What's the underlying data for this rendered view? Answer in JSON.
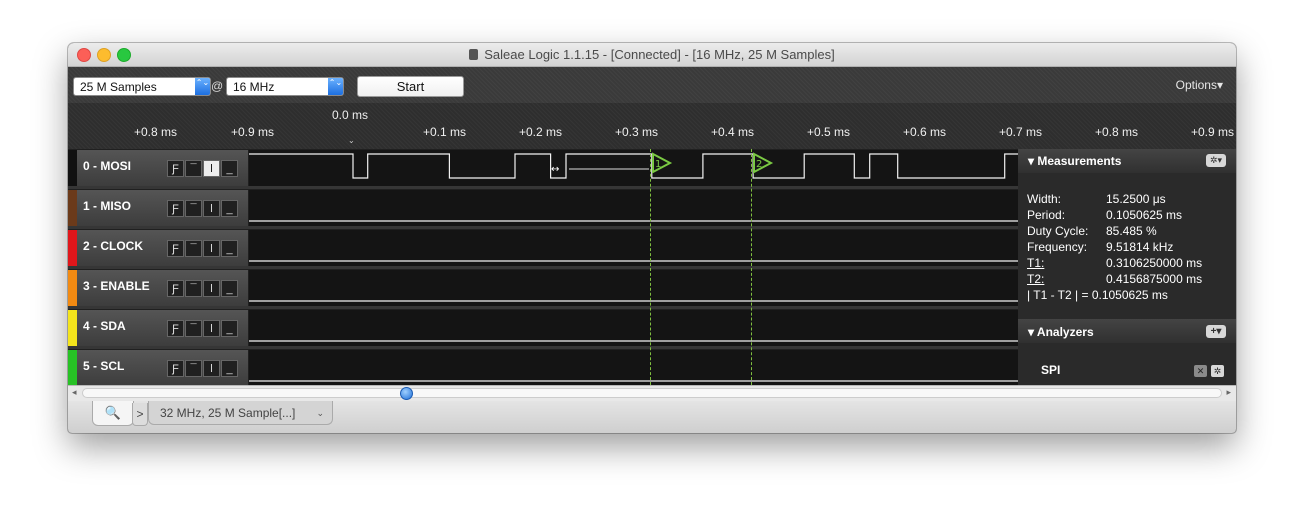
{
  "window": {
    "title": "Saleae Logic 1.1.15 - [Connected] - [16 MHz, 25 M Samples]"
  },
  "toolbar": {
    "samples_value": "25 M Samples",
    "at_symbol": "@",
    "rate_value": "16 MHz",
    "start_label": "Start",
    "options_label": "Options▾",
    "select_arrow": "⌃⌄"
  },
  "ruler": {
    "zero_label": "0.0 ms",
    "ticks": [
      "+0.8 ms",
      "+0.9 ms",
      "+0.1 ms",
      "+0.2 ms",
      "+0.3 ms",
      "+0.4 ms",
      "+0.5 ms",
      "+0.6 ms",
      "+0.7 ms",
      "+0.8 ms",
      "+0.9 ms"
    ]
  },
  "channels": [
    {
      "name": "0 - MOSI",
      "color": "#111111"
    },
    {
      "name": "1 - MISO",
      "color": "#6b3a1a"
    },
    {
      "name": "2 - CLOCK",
      "color": "#e0161b"
    },
    {
      "name": "3 - ENABLE",
      "color": "#f28a12"
    },
    {
      "name": "4 - SDA",
      "color": "#f4e41c"
    },
    {
      "name": "5 - SCL",
      "color": "#27c125"
    }
  ],
  "trigger_glyphs": [
    "Ƒ",
    "¯",
    "Ɩ",
    "_"
  ],
  "markers": {
    "m1": "1",
    "m2": "2"
  },
  "measurements": {
    "title": "Measurements",
    "gear": "✲▾",
    "rows": [
      {
        "label": "Width:",
        "value": "15.2500 μs"
      },
      {
        "label": "Period:",
        "value": "0.1050625 ms"
      },
      {
        "label": "Duty Cycle:",
        "value": "85.485 %"
      },
      {
        "label": "Frequency:",
        "value": "9.51814 kHz"
      },
      {
        "label": "T1:",
        "value": "0.3106250000 ms"
      },
      {
        "label": "T2:",
        "value": "0.4156875000 ms"
      }
    ],
    "diff_label": "| T1 - T2 | = 0.1050625 ms"
  },
  "analyzers": {
    "title": "Analyzers",
    "add": "+▾",
    "items": [
      {
        "name": "SPI",
        "remove": "✕",
        "gear": "✲"
      }
    ]
  },
  "tabs": {
    "search_icon": "🔍",
    "arrow": ">",
    "session_label": "32 MHz, 25 M Sample[...]",
    "session_dd": "⌄"
  },
  "chart_data": {
    "type": "line",
    "title": "",
    "channel": "0 - MOSI",
    "levels": [
      1,
      0,
      1,
      0,
      1,
      0,
      1,
      0,
      1,
      0,
      1,
      0,
      1,
      0,
      1,
      0,
      1,
      0,
      1
    ],
    "transition_ms": [
      0.0,
      0.0152,
      0.1,
      0.168,
      0.205,
      0.221,
      0.31,
      0.363,
      0.415,
      0.468,
      0.52,
      0.536,
      0.565,
      0.676,
      0.733
    ]
  }
}
